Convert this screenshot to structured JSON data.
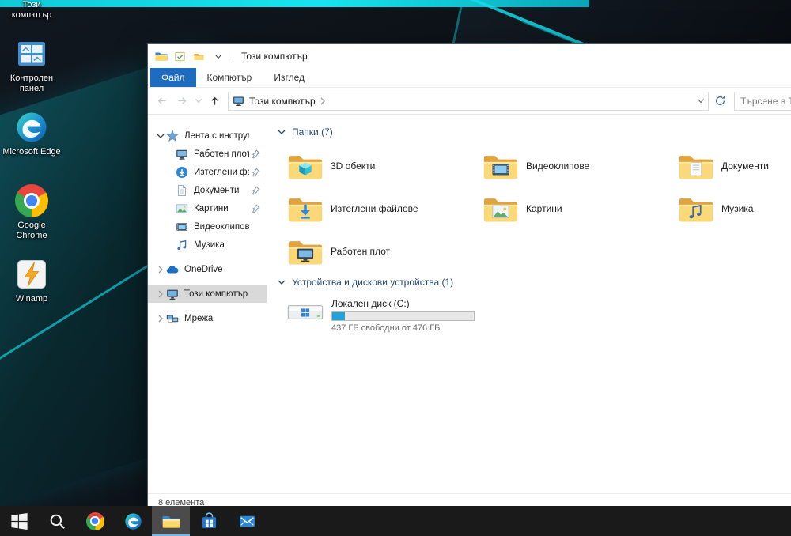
{
  "desktop": {
    "icons": [
      {
        "name": "this-pc",
        "label": "Този компютър",
        "icon": "pc-desktop"
      },
      {
        "name": "control-panel",
        "label": "Контролен панел",
        "icon": "control-panel"
      },
      {
        "name": "microsoft-edge",
        "label": "Microsoft Edge",
        "icon": "edge"
      },
      {
        "name": "google-chrome",
        "label": "Google Chrome",
        "icon": "chrome"
      },
      {
        "name": "winamp",
        "label": "Winamp",
        "icon": "winamp"
      }
    ]
  },
  "explorer": {
    "titlebar": {
      "title": "Този компютър"
    },
    "ribbon_tabs": [
      {
        "name": "file",
        "label": "Файл",
        "active": true
      },
      {
        "name": "computer",
        "label": "Компютър",
        "active": false
      },
      {
        "name": "view",
        "label": "Изглед",
        "active": false
      }
    ],
    "address_bar": {
      "breadcrumb": "Този компютър",
      "search_placeholder": "Търсене в Този компютър"
    },
    "nav_pane": {
      "items": [
        {
          "label": "Лента с инструменти",
          "icon": "star",
          "level": 0,
          "expanded": true,
          "pinned": false
        },
        {
          "label": "Работен плот",
          "icon": "nav-desktop",
          "level": 1,
          "pinned": true
        },
        {
          "label": "Изтеглени файлове",
          "icon": "nav-downloads",
          "level": 1,
          "pinned": true
        },
        {
          "label": "Документи",
          "icon": "nav-documents",
          "level": 1,
          "pinned": true
        },
        {
          "label": "Картини",
          "icon": "nav-pictures",
          "level": 1,
          "pinned": true
        },
        {
          "label": "Видеоклипове",
          "icon": "nav-videos",
          "level": 1,
          "pinned": false
        },
        {
          "label": "Музика",
          "icon": "nav-music",
          "level": 1,
          "pinned": false
        },
        {
          "label": "OneDrive",
          "icon": "onedrive",
          "level": 0,
          "chevron": true,
          "gap": true
        },
        {
          "label": "Този компютър",
          "icon": "nav-pc",
          "level": 0,
          "chevron": true,
          "gap": true,
          "selected": true
        },
        {
          "label": "Мрежа",
          "icon": "nav-network",
          "level": 0,
          "chevron": true,
          "gap": true
        }
      ]
    },
    "content": {
      "folders": {
        "header": "Папки (7)",
        "items": [
          {
            "label": "3D обекти",
            "icon": "folder-3d"
          },
          {
            "label": "Видеоклипове",
            "icon": "folder-video"
          },
          {
            "label": "Документи",
            "icon": "folder-docs"
          },
          {
            "label": "Изтеглени файлове",
            "icon": "folder-downloads"
          },
          {
            "label": "Картини",
            "icon": "folder-pictures"
          },
          {
            "label": "Музика",
            "icon": "folder-music"
          },
          {
            "label": "Работен плот",
            "icon": "folder-desktop"
          }
        ]
      },
      "devices": {
        "header": "Устройства и дискови устройства (1)",
        "items": [
          {
            "label": "Локален диск (C:)",
            "icon": "drive",
            "free_text": "437 ГБ свободни от 476 ГБ",
            "used_percent": 9
          }
        ]
      }
    },
    "status_bar": {
      "items_count": "8 елемента"
    }
  },
  "taskbar": {
    "buttons": [
      {
        "name": "start",
        "icon": "windows"
      },
      {
        "name": "search",
        "icon": "search"
      },
      {
        "name": "chrome",
        "icon": "chrome"
      },
      {
        "name": "edge",
        "icon": "edge"
      },
      {
        "name": "file-explorer",
        "icon": "explorer",
        "active": true
      },
      {
        "name": "store",
        "icon": "store"
      },
      {
        "name": "mail",
        "icon": "mail"
      }
    ]
  },
  "colors": {
    "accent_cyan": "#17dbe6",
    "file_tab_blue": "#1d6cc0",
    "nav_selection": "#d9d9d9",
    "drive_bar_fill": "#26a0da",
    "taskbar_bg": "#1a1a1a"
  }
}
